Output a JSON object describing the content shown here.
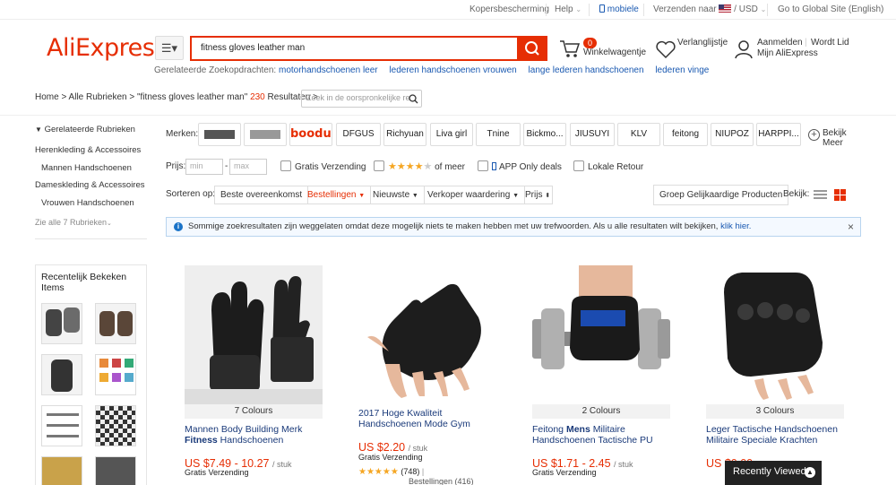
{
  "topbar": {
    "buyer_protection": "Kopersbescherming",
    "help": "Help",
    "mobile": "mobiele",
    "ship_to": "Verzenden naar",
    "currency": "USD",
    "global_site": "Go to Global Site (English)"
  },
  "header": {
    "logo": "AliExpress",
    "search_value": "fitness gloves leather man",
    "related_label": "Gerelateerde Zoekopdrachten:",
    "related": [
      "motorhandschoenen leer",
      "lederen handschoenen vrouwen",
      "lange lederen handschoenen",
      "lederen vinge"
    ],
    "cart_count": "0",
    "cart_label": "Winkelwagentje",
    "wishlist_label": "Verlanglijstje",
    "signin": "Aanmelden",
    "join": "Wordt Lid",
    "my_aliexpress": "Mijn AliExpress"
  },
  "breadcrumb": {
    "home": "Home",
    "all": "Alle Rubrieken",
    "query": "\"fitness gloves leather man\"",
    "count": "230",
    "results": "Resultaten",
    "within_placeholder": "Zoek in de oorspronkelijke re"
  },
  "sidebar": {
    "heading": "Gerelateerde Rubrieken",
    "items": [
      "Herenkleding & Accessoires",
      "Mannen Handschoenen",
      "Dameskleding & Accessoires",
      "Vrouwen Handschoenen"
    ],
    "see_all": "Zie alle 7 Rubrieken",
    "recent_title": "Recentelijk Bekeken Items"
  },
  "filters": {
    "brands_label": "Merken:",
    "brand_names": [
      "DFGUS",
      "Richyuan",
      "Liva girl",
      "Tnine",
      "Bickmo...",
      "JIUSUYI",
      "KLV",
      "feitong",
      "NIUPOZ",
      "HARPPI..."
    ],
    "logo_brand_text": "boodun",
    "see_more": "Bekijk Meer",
    "price_label": "Prijs:",
    "min": "min",
    "max": "max",
    "free_shipping": "Gratis Verzending",
    "rating_more": "of meer",
    "app_only": "APP Only deals",
    "local_return": "Lokale Retour",
    "sort_label": "Sorteren op:",
    "sort_options": [
      "Beste overeenkomst",
      "Bestellingen",
      "Nieuwste",
      "Verkoper waardering",
      "Prijs"
    ],
    "group_similar": "Groep Gelijkaardige Producten",
    "view_label": "Bekijk:"
  },
  "notice": {
    "text": "Sommige zoekresultaten zijn weggelaten omdat deze mogelijk niets te maken hebben met uw trefwoorden. Als u alle resultaten wilt bekijken,",
    "link": "klik hier."
  },
  "products": [
    {
      "colours": "7 Colours",
      "title_a": "Mannen Body Building Merk ",
      "title_b": "Fitness",
      "title_c": " Handschoenen",
      "price": "US $7.49 - 10.27",
      "unit": "/ stuk",
      "shipping": "Gratis Verzending"
    },
    {
      "colours": "",
      "title_a": "2017 Hoge Kwaliteit Handschoenen Mode Gym",
      "title_b": "",
      "title_c": "",
      "price": "US $2.20",
      "unit": "/ stuk",
      "shipping": "Gratis Verzending",
      "reviews": "(748)",
      "orders": "Bestellingen (416)",
      "rating": 5
    },
    {
      "colours": "2 Colours",
      "title_a": "Feitong ",
      "title_b": "Mens",
      "title_c": " Militaire Handschoenen Tactische PU",
      "price": "US $1.71 - 2.45",
      "unit": "/ stuk",
      "shipping": "Gratis Verzending"
    },
    {
      "colours": "3 Colours",
      "title_a": "Leger Tactische Handschoenen Militaire Speciale Krachten",
      "title_b": "",
      "title_c": "",
      "price": "US $0.00",
      "unit": "",
      "shipping": ""
    }
  ],
  "recently_viewed": "Recently Viewed",
  "colors": {
    "accent": "#e62e04",
    "link": "#1a59b1",
    "star": "#f5a623"
  }
}
